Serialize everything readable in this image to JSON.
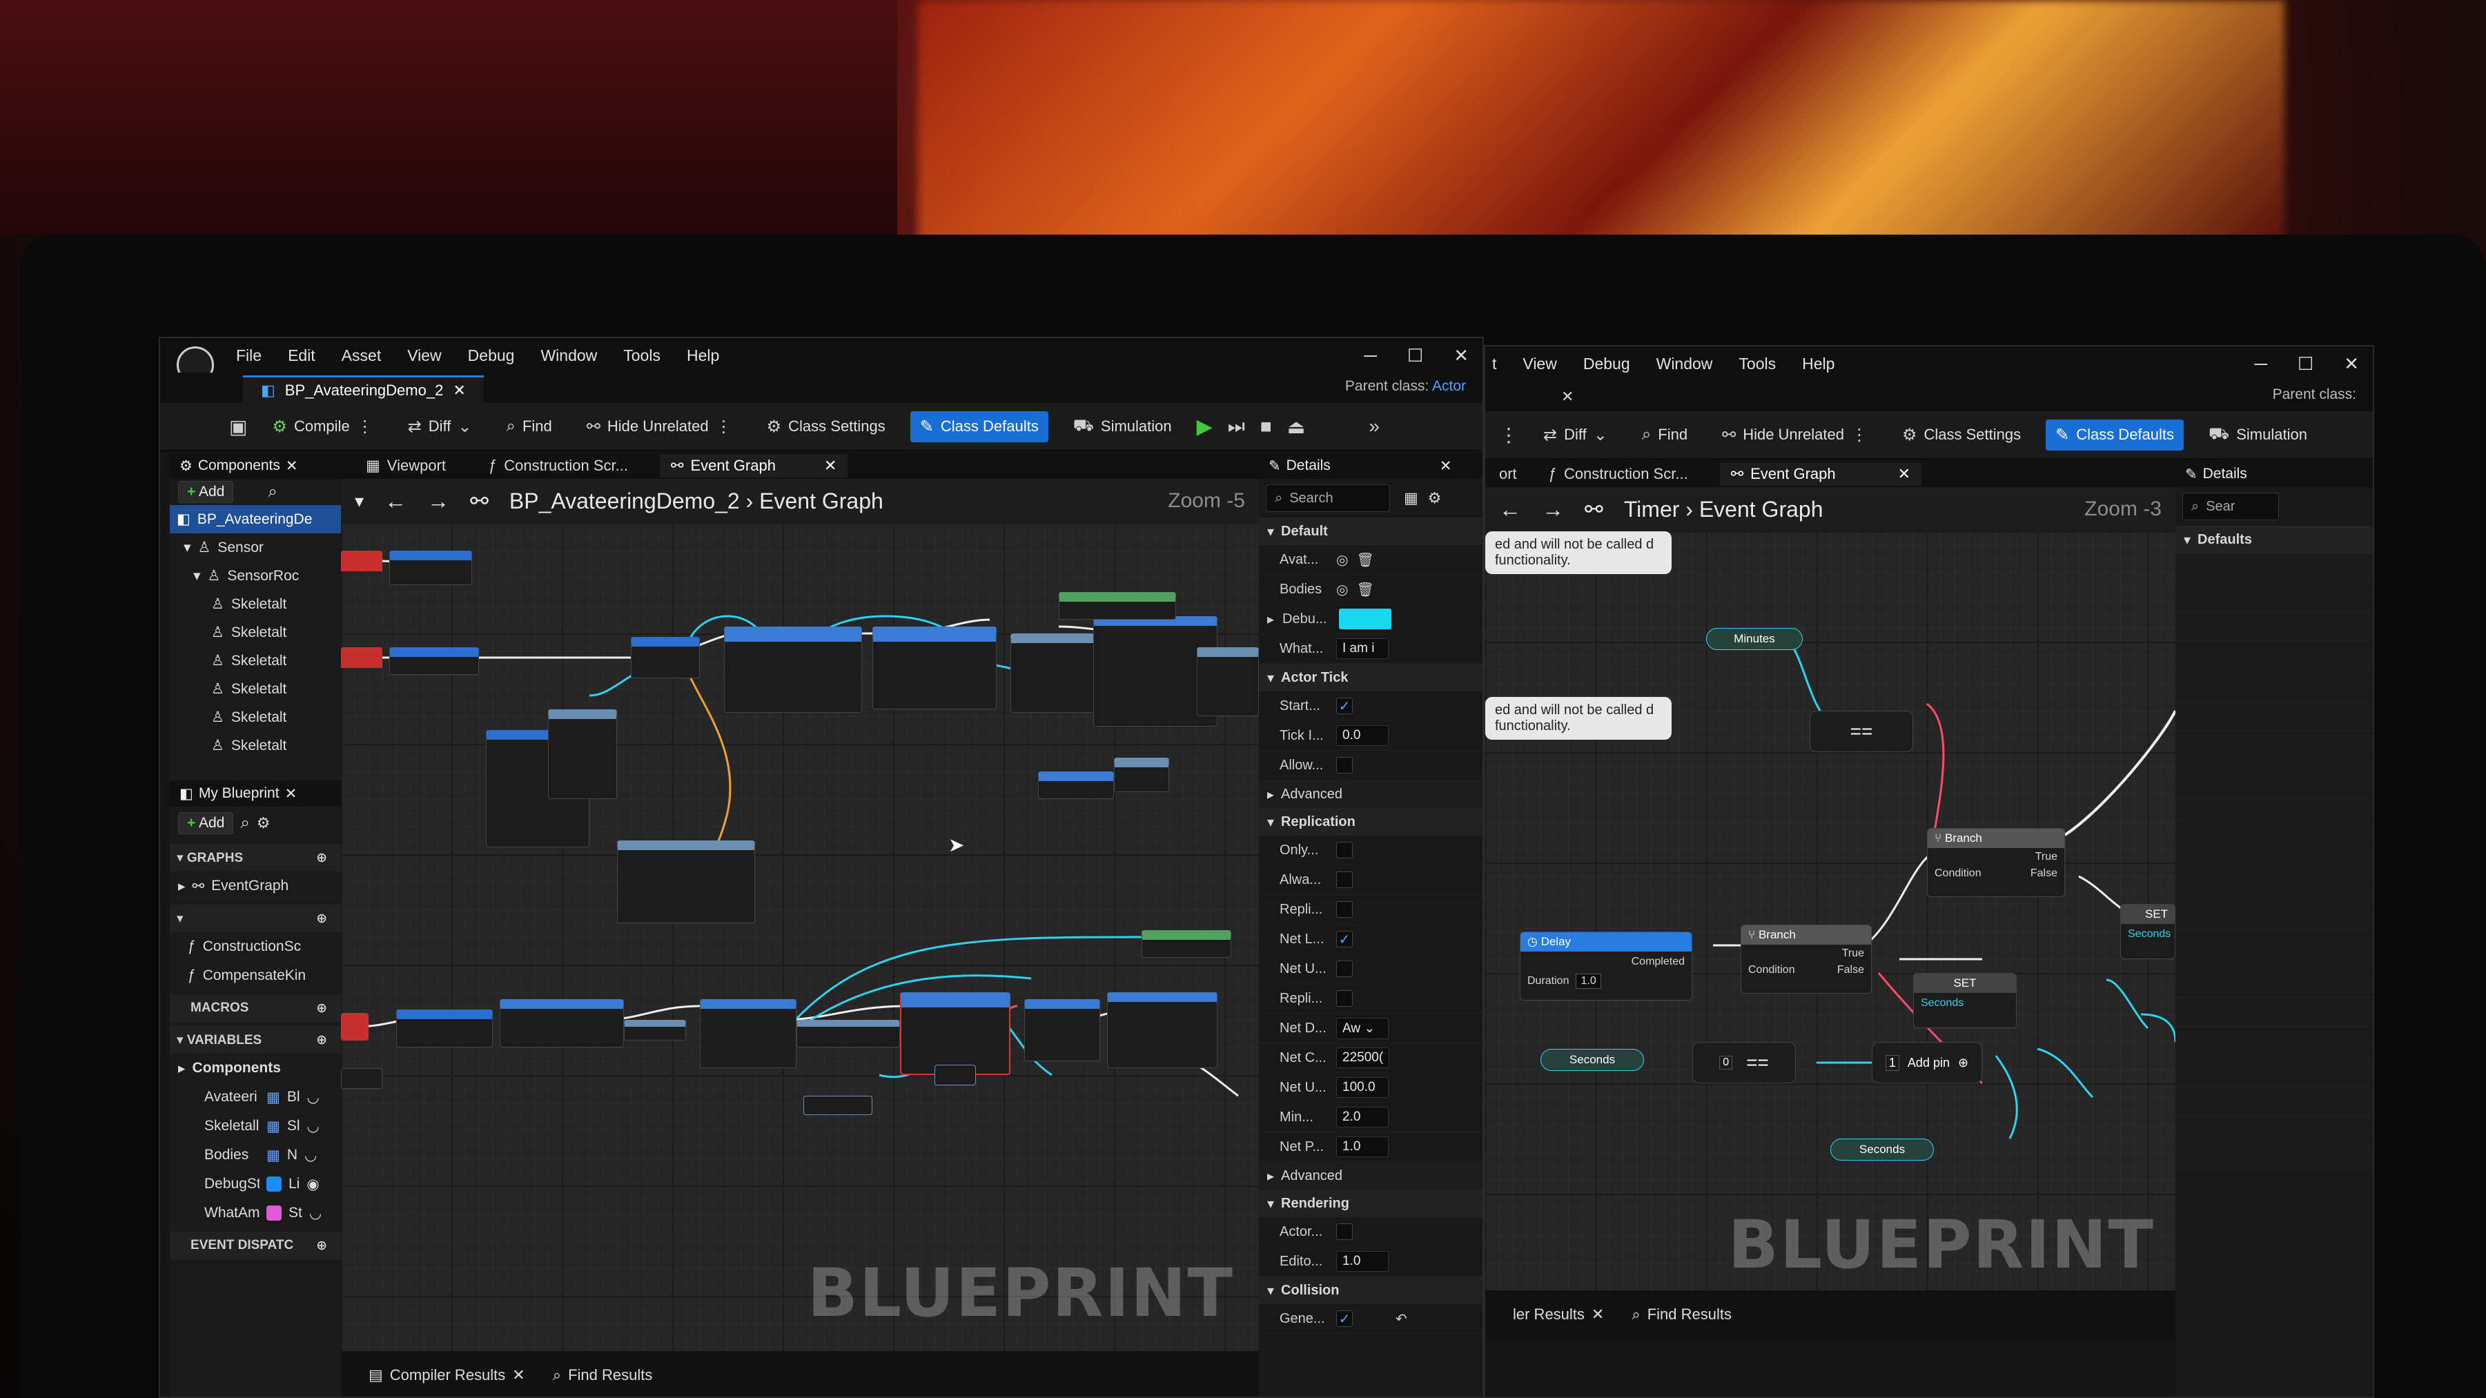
{
  "menu": [
    "File",
    "Edit",
    "Asset",
    "View",
    "Debug",
    "Window",
    "Tools",
    "Help"
  ],
  "right_menu": [
    "t",
    "View",
    "Debug",
    "Window",
    "Tools",
    "Help"
  ],
  "asset_tab": "BP_AvateeringDemo_2",
  "parent_class_label": "Parent class:",
  "parent_class_value": "Actor",
  "toolbar": {
    "compile": "Compile",
    "diff": "Diff",
    "find": "Find",
    "hide_unrelated": "Hide Unrelated",
    "class_settings": "Class Settings",
    "class_defaults": "Class Defaults",
    "simulation": "Simulation"
  },
  "components": {
    "tab": "Components",
    "add": "Add",
    "items": [
      "BP_AvateeringDe",
      "Sensor",
      "SensorRoc",
      "Skeletalt",
      "Skeletalt",
      "Skeletalt",
      "Skeletalt",
      "Skeletalt",
      "Skeletalt"
    ]
  },
  "my_blueprint": {
    "tab": "My Blueprint",
    "add": "Add",
    "graphs_hd": "GRAPHS",
    "event_graph": "EventGraph",
    "functions_hd": "",
    "functions": [
      "ConstructionSc",
      "CompensateKin"
    ],
    "macros_hd": "MACROS",
    "variables_hd": "VARIABLES",
    "components_group": "Components",
    "variables": [
      {
        "name": "Avateeri",
        "type": "Bl",
        "color": "#5fa0ff"
      },
      {
        "name": "Skeletall",
        "type": "Sl",
        "color": "#5fa0ff"
      },
      {
        "name": "Bodies",
        "type": "N",
        "color": "#5fa0ff"
      },
      {
        "name": "DebugSt",
        "type": "Li",
        "color": "#1a8cff"
      },
      {
        "name": "WhatAm",
        "type": "St",
        "color": "#e05ad8"
      }
    ],
    "event_dispatch_hd": "EVENT DISPATC"
  },
  "graph_tabs": {
    "viewport": "Viewport",
    "construction": "Construction Scr...",
    "event_graph": "Event Graph"
  },
  "breadcrumb": {
    "asset": "BP_AvateeringDemo_2",
    "graph": "Event Graph"
  },
  "zoom": "Zoom -5",
  "watermark": "BLUEPRINT",
  "bottom_tabs": {
    "compiler": "Compiler Results",
    "find": "Find Results"
  },
  "details": {
    "tab": "Details",
    "search": "Search",
    "categories": {
      "default": "Default",
      "actor_tick": "Actor Tick",
      "advanced": "Advanced",
      "replication": "Replication",
      "advanced2": "Advanced",
      "rendering": "Rendering",
      "collision": "Collision"
    },
    "default_rows": [
      {
        "label": "Avat..."
      },
      {
        "label": "Bodies"
      },
      {
        "label": "Debu..."
      },
      {
        "label": "What...",
        "value": "I am i"
      }
    ],
    "tick_rows": [
      {
        "label": "Start...",
        "checked": true
      },
      {
        "label": "Tick I...",
        "value": "0.0"
      },
      {
        "label": "Allow...",
        "checked": false
      }
    ],
    "replication_rows": [
      {
        "label": "Only...",
        "checked": false
      },
      {
        "label": "Alwa...",
        "checked": false
      },
      {
        "label": "Repli...",
        "checked": false
      },
      {
        "label": "Net L...",
        "checked": true
      },
      {
        "label": "Net U...",
        "checked": false
      },
      {
        "label": "Repli...",
        "checked": false
      },
      {
        "label": "Net D...",
        "value": "Aw"
      },
      {
        "label": "Net C...",
        "value": "22500("
      },
      {
        "label": "Net U...",
        "value": "100.0"
      },
      {
        "label": "Min...",
        "value": "2.0"
      },
      {
        "label": "Net P...",
        "value": "1.0"
      }
    ],
    "rendering_rows": [
      {
        "label": "Actor...",
        "checked": false
      },
      {
        "label": "Edito...",
        "value": "1.0"
      }
    ],
    "collision_rows": [
      {
        "label": "Gene...",
        "checked": true
      }
    ]
  },
  "right_window": {
    "breadcrumb": {
      "asset": "Timer",
      "graph": "Event Graph"
    },
    "zoom": "Zoom -3",
    "tabs": {
      "left_partial": "ort",
      "construction": "Construction Scr...",
      "event_graph": "Event Graph"
    },
    "comment": "ed and will not be called d functionality.",
    "details_tab": "Details",
    "details_search": "Sear",
    "defaults_cat": "Defaults",
    "nodes": {
      "minutes": "Minutes",
      "delay": "Delay",
      "completed": "Completed",
      "duration": "Duration",
      "duration_value": "1.0",
      "branch": "Branch",
      "true_pin": "True",
      "false_pin": "False",
      "condition": "Condition",
      "set": "SET",
      "seconds": "Seconds",
      "add_pin": "Add pin",
      "value_1": "1",
      "value_0": "0"
    },
    "bottom": {
      "results_partial": "ler Results",
      "find": "Find Results"
    }
  }
}
